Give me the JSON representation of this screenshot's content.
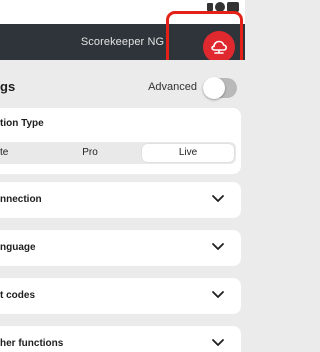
{
  "app": {
    "title": "Scorekeeper NG"
  },
  "settings": {
    "title_fragment": "gs",
    "advanced_label": "Advanced",
    "advanced_enabled": false
  },
  "connection": {
    "title_fragment": "tion Type",
    "options": [
      "te",
      "Pro",
      "Live"
    ],
    "selected": "Live"
  },
  "sections": [
    {
      "label": "nnection"
    },
    {
      "label": "nguage"
    },
    {
      "label": "t codes"
    },
    {
      "label": "her functions"
    }
  ],
  "icons": {
    "sync": "cloud-sync-icon",
    "chevron": "chevron-down-icon"
  },
  "colors": {
    "app_bar": "#2e3439",
    "accent": "#e0282f",
    "background": "#ebebeb"
  }
}
